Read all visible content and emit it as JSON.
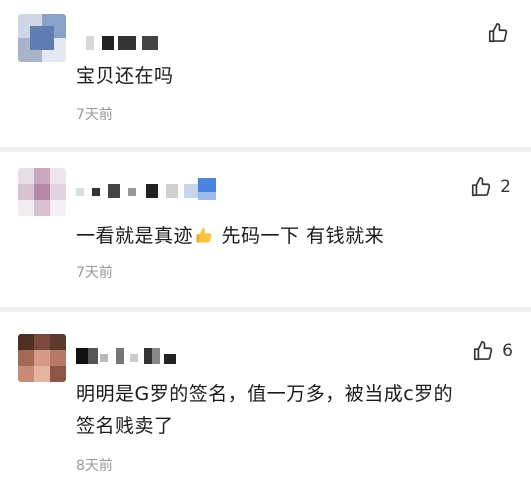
{
  "comments": [
    {
      "text": "宝贝还在吗",
      "time": "7天前",
      "likes": "",
      "username_obscured": true
    },
    {
      "text_before": "一看就是真迹",
      "text_after": " 先码一下 有钱就来",
      "emoji": "thumbs-up-emoji",
      "time": "7天前",
      "likes": "2",
      "username_obscured": true
    },
    {
      "text_line1": "明明是G罗的签名，值一万多，被当成c罗的",
      "text_line2": "签名贱卖了",
      "time": "8天前",
      "likes": "6",
      "username_obscured": true
    }
  ],
  "icons": {
    "like": "thumbs-up-outline-icon"
  },
  "colors": {
    "divider": "#f0f0f0",
    "time": "#9a9a9a",
    "text": "#1a1a1a"
  }
}
